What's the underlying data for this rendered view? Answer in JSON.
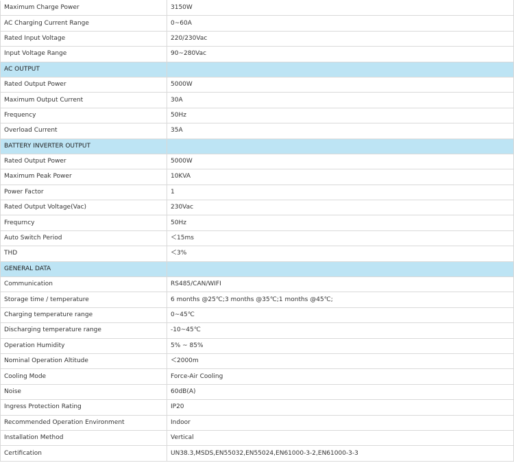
{
  "colors": {
    "section_header_bg": "#bde4f4",
    "border": "#d9d9d9",
    "text": "#333333"
  },
  "rows": [
    {
      "type": "row",
      "label": "Maximum Charge Power",
      "value": "3150W"
    },
    {
      "type": "row",
      "label": "AC Charging Current Range",
      "value": "0~60A"
    },
    {
      "type": "row",
      "label": "Rated Input Voltage",
      "value": "220/230Vac"
    },
    {
      "type": "row",
      "label": "Input Voltage Range",
      "value": "90~280Vac"
    },
    {
      "type": "section",
      "label": "AC OUTPUT",
      "value": ""
    },
    {
      "type": "row",
      "label": "Rated Output Power",
      "value": "5000W"
    },
    {
      "type": "row",
      "label": "Maximum Output Current",
      "value": "30A"
    },
    {
      "type": "row",
      "label": "Frequency",
      "value": "50Hz"
    },
    {
      "type": "row",
      "label": "Overload Current",
      "value": "35A"
    },
    {
      "type": "section",
      "label": "BATTERY INVERTER OUTPUT",
      "value": ""
    },
    {
      "type": "row",
      "label": "Rated Output Power",
      "value": "5000W"
    },
    {
      "type": "row",
      "label": "Maximum Peak Power",
      "value": "10KVA"
    },
    {
      "type": "row",
      "label": "Power Factor",
      "value": "1"
    },
    {
      "type": "row",
      "label": "Rated Output Voltage(Vac)",
      "value": "230Vac"
    },
    {
      "type": "row",
      "label": "Frequrncy",
      "value": "50Hz"
    },
    {
      "type": "row",
      "label": "Auto Switch Period",
      "value": "＜15ms"
    },
    {
      "type": "row",
      "label": "THD",
      "value": "＜3%"
    },
    {
      "type": "section",
      "label": "GENERAL DATA",
      "value": ""
    },
    {
      "type": "row",
      "label": "Communication",
      "value": "RS485/CAN/WIFI"
    },
    {
      "type": "row",
      "label": "Storage time / temperature",
      "value": "6 months @25℃;3 months @35℃;1 months @45℃;"
    },
    {
      "type": "row",
      "label": "Charging temperature range",
      "value": "0~45℃"
    },
    {
      "type": "row",
      "label": "Discharging temperature range",
      "value": "-10~45℃"
    },
    {
      "type": "row",
      "label": "Operation Humidity",
      "value": "5% ~ 85%"
    },
    {
      "type": "row",
      "label": "Nominal Operation Altitude",
      "value": "＜2000m"
    },
    {
      "type": "row",
      "label": "Cooling Mode",
      "value": "Force-Air Cooling"
    },
    {
      "type": "row",
      "label": "Noise",
      "value": "60dB(A)"
    },
    {
      "type": "row",
      "label": "Ingress Protection Rating",
      "value": "IP20"
    },
    {
      "type": "row",
      "label": "Recommended Operation Environment",
      "value": "Indoor"
    },
    {
      "type": "row",
      "label": "Installation Method",
      "value": "Vertical"
    },
    {
      "type": "row",
      "label": "Certification",
      "value": "UN38.3,MSDS,EN55032,EN55024,EN61000-3-2,EN61000-3-3"
    }
  ]
}
